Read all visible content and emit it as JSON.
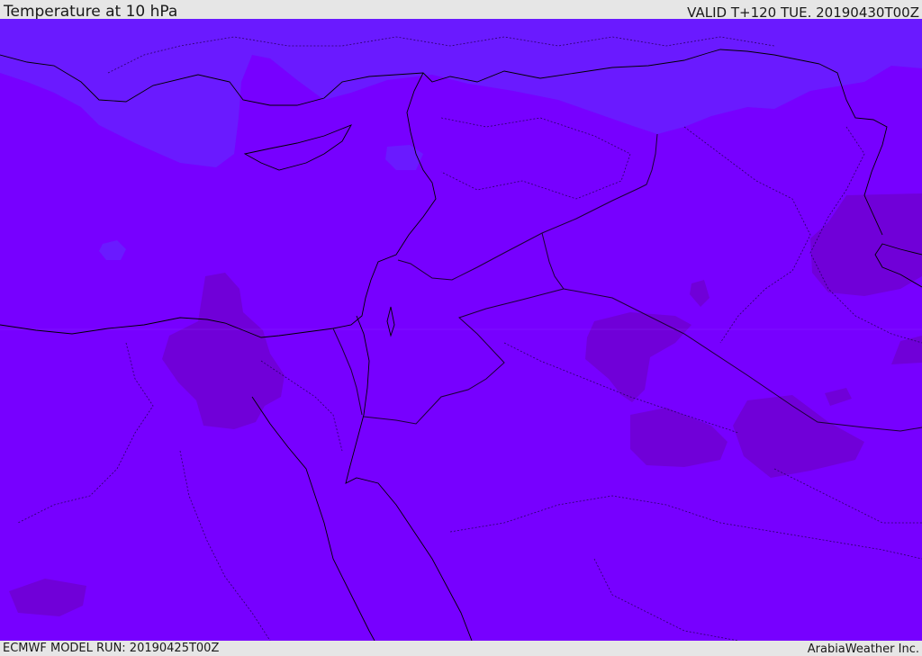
{
  "header": {
    "title": "Temperature at 10 hPa",
    "valid_time": "VALID T+120 TUE. 20190430T00Z"
  },
  "footer": {
    "model_run": "ECMWF MODEL RUN: 20190425T00Z",
    "credit": "ArabiaWeather Inc."
  },
  "map": {
    "colors": {
      "base": "#7700ff",
      "cool": "#6a1aff",
      "warm": "#7000d8",
      "coastline": "#000000",
      "border": "#1a0033"
    }
  }
}
